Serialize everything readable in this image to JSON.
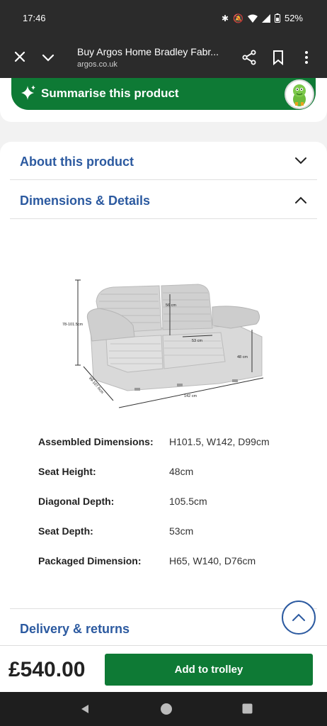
{
  "status": {
    "time": "17:46",
    "battery": "52%",
    "icons": [
      "bluetooth-icon",
      "mute-icon",
      "wifi-icon",
      "signal-icon",
      "battery-icon"
    ]
  },
  "browser": {
    "title": "Buy Argos Home Bradley Fabr...",
    "url": "argos.co.uk"
  },
  "summarise": {
    "label": "Summarise this product"
  },
  "accordions": {
    "about": "About this product",
    "dimensions": "Dimensions & Details",
    "delivery": "Delivery & returns"
  },
  "sofa_labels": {
    "height": "78-101.5cm",
    "seat_back": "56 cm",
    "seat_depth": "53 cm",
    "seat_height": "48 cm",
    "depth": "99-107.5cm",
    "width": "142 cm"
  },
  "details": [
    {
      "key": "Assembled Dimensions:",
      "value": "H101.5, W142, D99cm"
    },
    {
      "key": "Seat Height:",
      "value": "48cm"
    },
    {
      "key": "Diagonal Depth:",
      "value": "105.5cm"
    },
    {
      "key": "Seat Depth:",
      "value": "53cm"
    },
    {
      "key": "Packaged Dimension:",
      "value": "H65, W140, D76cm"
    }
  ],
  "buy": {
    "price": "£540.00",
    "button": "Add to trolley"
  },
  "colors": {
    "argos_green": "#0e7a35",
    "link_blue": "#2c5aa0"
  }
}
